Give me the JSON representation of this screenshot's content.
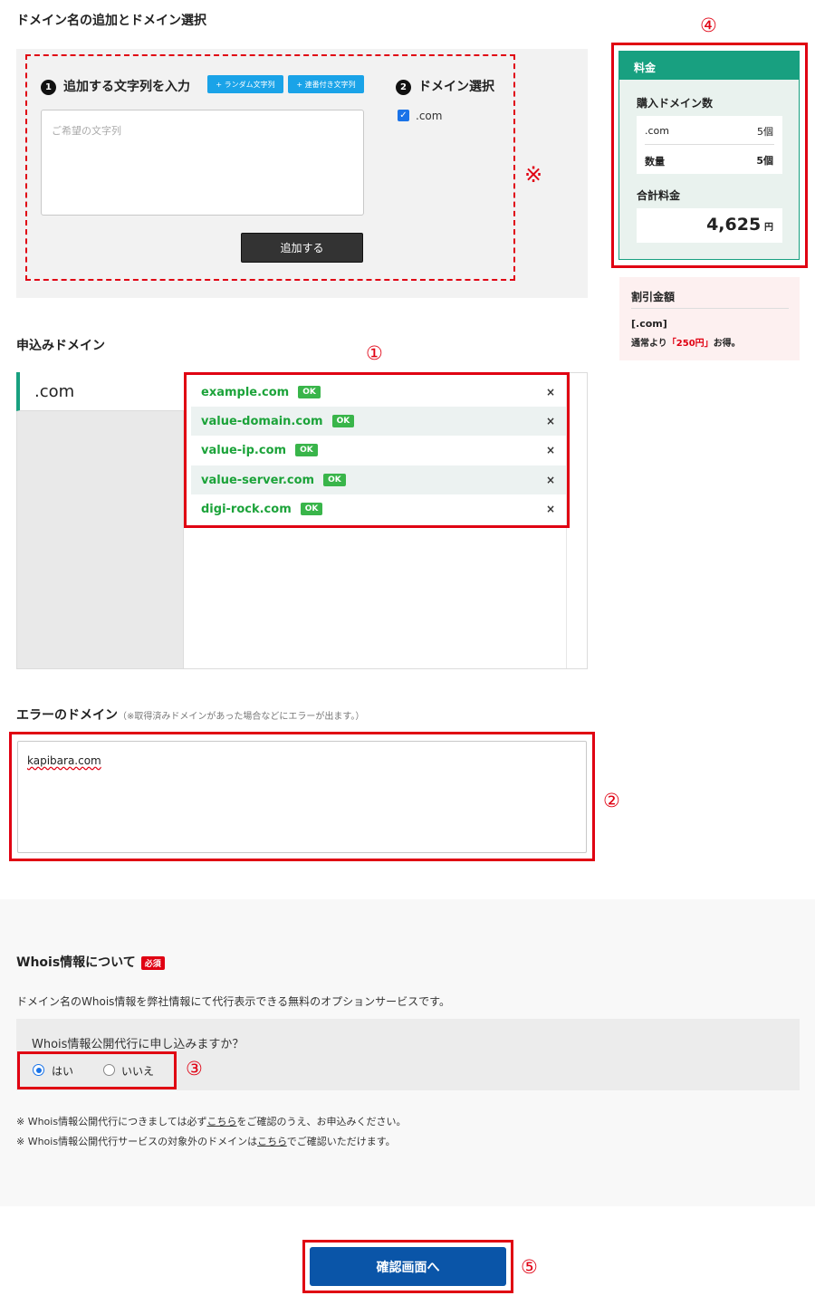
{
  "sections": {
    "add_title": "ドメイン名の追加とドメイン選択",
    "applied_title": "申込みドメイン",
    "error_title": "エラーのドメイン",
    "error_note": "（※取得済みドメインがあった場合などにエラーが出ます。）",
    "whois_title": "Whois情報について"
  },
  "step1": {
    "num": "1",
    "label": "追加する文字列を入力",
    "random_btn": "+ ランダム文字列",
    "serial_btn": "+ 連番付き文字列",
    "placeholder": "ご希望の文字列",
    "add_btn": "追加する"
  },
  "step2": {
    "num": "2",
    "label": "ドメイン選択",
    "option": ".com",
    "checked": true
  },
  "markers": {
    "m1": "①",
    "m2": "②",
    "m3": "③",
    "m4": "④",
    "m5": "⑤",
    "kome": "※"
  },
  "price": {
    "header": "料金",
    "count_title": "購入ドメイン数",
    "tld": ".com",
    "tld_count": "5個",
    "qty_label": "数量",
    "qty_value": "5個",
    "total_label": "合計料金",
    "total_value": "4,625",
    "total_unit": "円"
  },
  "discount": {
    "title": "割引金額",
    "tld": "[.com]",
    "line_prefix": "通常より",
    "amount": "「250円」",
    "line_suffix": "お得。"
  },
  "domain_list": {
    "tab": ".com",
    "items": [
      {
        "name": "example.com",
        "status": "OK"
      },
      {
        "name": "value-domain.com",
        "status": "OK"
      },
      {
        "name": "value-ip.com",
        "status": "OK"
      },
      {
        "name": "value-server.com",
        "status": "OK"
      },
      {
        "name": "digi-rock.com",
        "status": "OK"
      }
    ],
    "remove": "×"
  },
  "error_domains": "kapibara.com",
  "whois": {
    "required": "必須",
    "desc": "ドメイン名のWhois情報を弊社情報にて代行表示できる無料のオプションサービスです。",
    "question": "Whois情報公開代行に申し込みますか？",
    "yes": "はい",
    "no": "いいえ",
    "selected": "yes",
    "note1_a": "※ Whois情報公開代行につきましては必ず",
    "note1_link": "こちら",
    "note1_b": "をご確認のうえ、お申込みください。",
    "note2_a": "※ Whois情報公開代行サービスの対象外のドメインは",
    "note2_link": "こちら",
    "note2_b": "でご確認いただけます。"
  },
  "confirm_btn": "確認画面へ"
}
